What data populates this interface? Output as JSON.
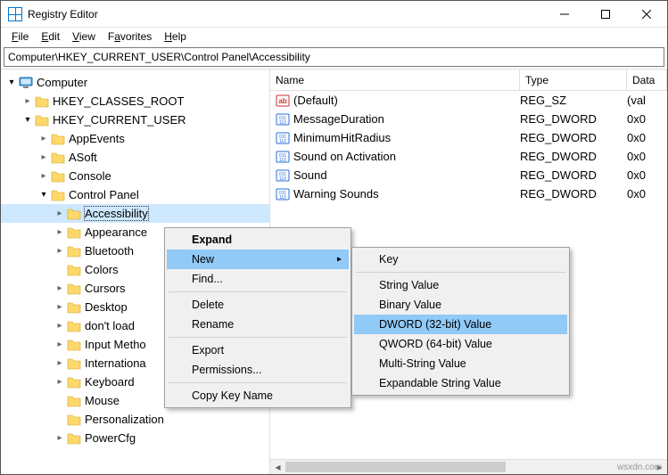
{
  "title": "Registry Editor",
  "menu": {
    "file": "File",
    "edit": "Edit",
    "view": "View",
    "favorites": "Favorites",
    "help": "Help"
  },
  "address": "Computer\\HKEY_CURRENT_USER\\Control Panel\\Accessibility",
  "tree": {
    "root": "Computer",
    "hkcr": "HKEY_CLASSES_ROOT",
    "hkcu": "HKEY_CURRENT_USER",
    "children": [
      "AppEvents",
      "ASoft",
      "Console",
      "Control Panel"
    ],
    "cp_children": [
      "Accessibility",
      "Appearance",
      "Bluetooth",
      "Colors",
      "Cursors",
      "Desktop",
      "don't load",
      "Input Metho",
      "Internationa",
      "Keyboard",
      "Mouse",
      "Personalization",
      "PowerCfg"
    ]
  },
  "columns": {
    "name": "Name",
    "type": "Type",
    "data": "Data"
  },
  "values": [
    {
      "name": "(Default)",
      "type": "REG_SZ",
      "data": "(val",
      "icon": "string"
    },
    {
      "name": "MessageDuration",
      "type": "REG_DWORD",
      "data": "0x0",
      "icon": "binary"
    },
    {
      "name": "MinimumHitRadius",
      "type": "REG_DWORD",
      "data": "0x0",
      "icon": "binary"
    },
    {
      "name": "Sound on Activation",
      "type": "REG_DWORD",
      "data": "0x0",
      "icon": "binary"
    },
    {
      "name": "Sound",
      "type": "REG_DWORD",
      "data": "0x0",
      "icon": "binary"
    },
    {
      "name": "Warning Sounds",
      "type": "REG_DWORD",
      "data": "0x0",
      "icon": "binary"
    }
  ],
  "context1": {
    "expand": "Expand",
    "new": "New",
    "find": "Find...",
    "delete": "Delete",
    "rename": "Rename",
    "export": "Export",
    "permissions": "Permissions...",
    "copy_key_name": "Copy Key Name"
  },
  "context2": {
    "key": "Key",
    "string": "String Value",
    "binary": "Binary Value",
    "dword": "DWORD (32-bit) Value",
    "qword": "QWORD (64-bit) Value",
    "multi": "Multi-String Value",
    "expand": "Expandable String Value"
  },
  "watermark": "wsxdn.com"
}
